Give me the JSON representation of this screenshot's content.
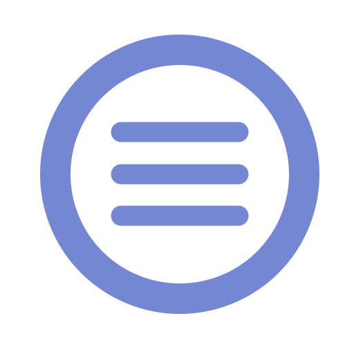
{
  "icon": {
    "name": "menu-icon",
    "color": "#7587D2",
    "background": "#FFFFFF"
  }
}
